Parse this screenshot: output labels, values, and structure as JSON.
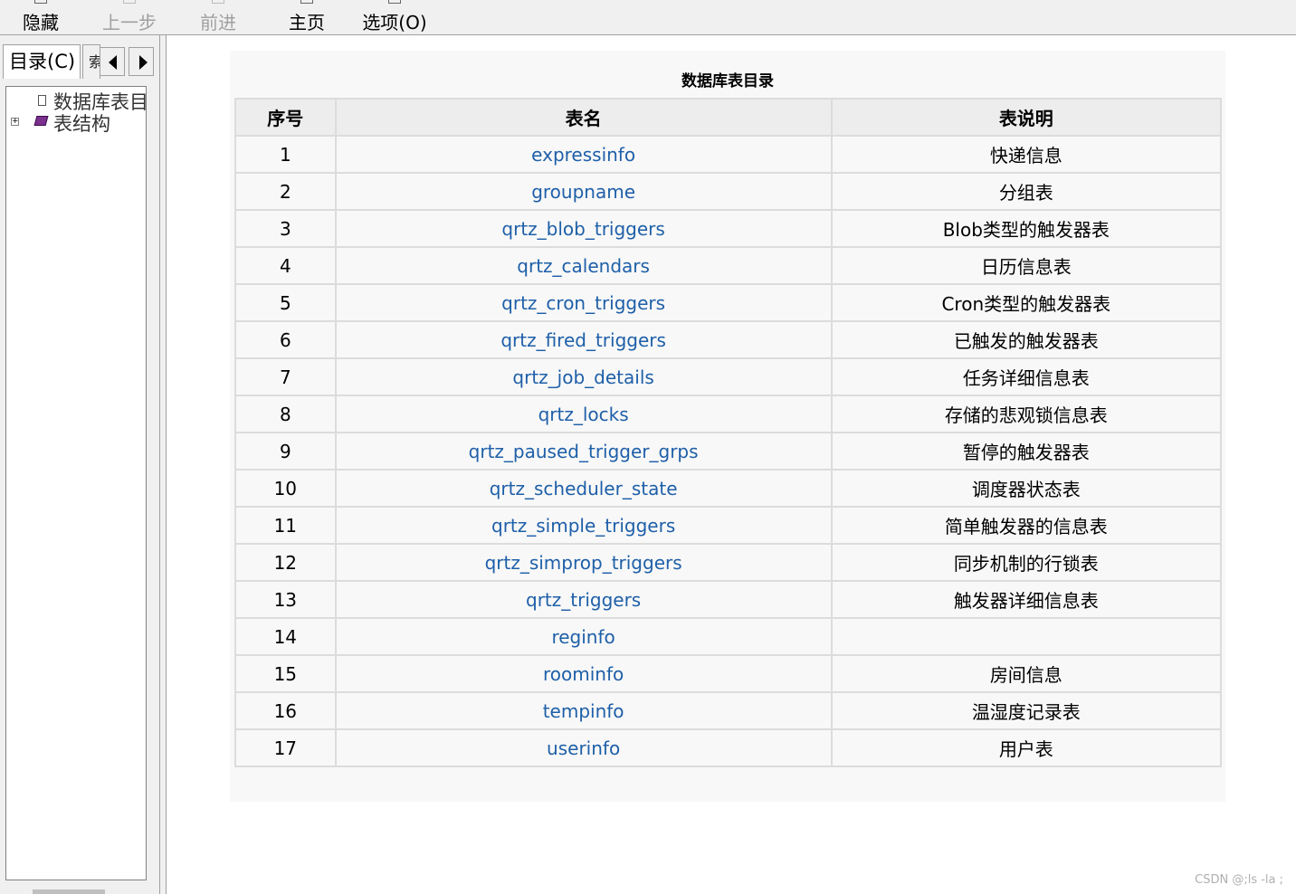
{
  "toolbar": {
    "hide": "隐藏",
    "back": "上一步",
    "forward": "前进",
    "home": "主页",
    "options": "选项(O)"
  },
  "sidebar": {
    "tab_contents": "目录(C)",
    "tab_other": "索",
    "tree": [
      {
        "label": "数据库表目",
        "icon": "page-icon"
      },
      {
        "label": "表结构",
        "icon": "book-icon"
      }
    ]
  },
  "main": {
    "caption": "数据库表目录",
    "headers": [
      "序号",
      "表名",
      "表说明"
    ],
    "rows": [
      {
        "no": "1",
        "name": "expressinfo",
        "desc": "快递信息"
      },
      {
        "no": "2",
        "name": "groupname",
        "desc": "分组表"
      },
      {
        "no": "3",
        "name": "qrtz_blob_triggers",
        "desc": "Blob类型的触发器表"
      },
      {
        "no": "4",
        "name": "qrtz_calendars",
        "desc": "日历信息表"
      },
      {
        "no": "5",
        "name": "qrtz_cron_triggers",
        "desc": "Cron类型的触发器表"
      },
      {
        "no": "6",
        "name": "qrtz_fired_triggers",
        "desc": "已触发的触发器表"
      },
      {
        "no": "7",
        "name": "qrtz_job_details",
        "desc": "任务详细信息表"
      },
      {
        "no": "8",
        "name": "qrtz_locks",
        "desc": "存储的悲观锁信息表"
      },
      {
        "no": "9",
        "name": "qrtz_paused_trigger_grps",
        "desc": "暂停的触发器表"
      },
      {
        "no": "10",
        "name": "qrtz_scheduler_state",
        "desc": "调度器状态表"
      },
      {
        "no": "11",
        "name": "qrtz_simple_triggers",
        "desc": "简单触发器的信息表"
      },
      {
        "no": "12",
        "name": "qrtz_simprop_triggers",
        "desc": "同步机制的行锁表"
      },
      {
        "no": "13",
        "name": "qrtz_triggers",
        "desc": "触发器详细信息表"
      },
      {
        "no": "14",
        "name": "reginfo",
        "desc": ""
      },
      {
        "no": "15",
        "name": "roominfo",
        "desc": "房间信息"
      },
      {
        "no": "16",
        "name": "tempinfo",
        "desc": "温湿度记录表"
      },
      {
        "no": "17",
        "name": "userinfo",
        "desc": "用户表"
      }
    ]
  },
  "watermark": "CSDN @;ls -la ;",
  "colors": {
    "link": "#1e5fa8"
  }
}
